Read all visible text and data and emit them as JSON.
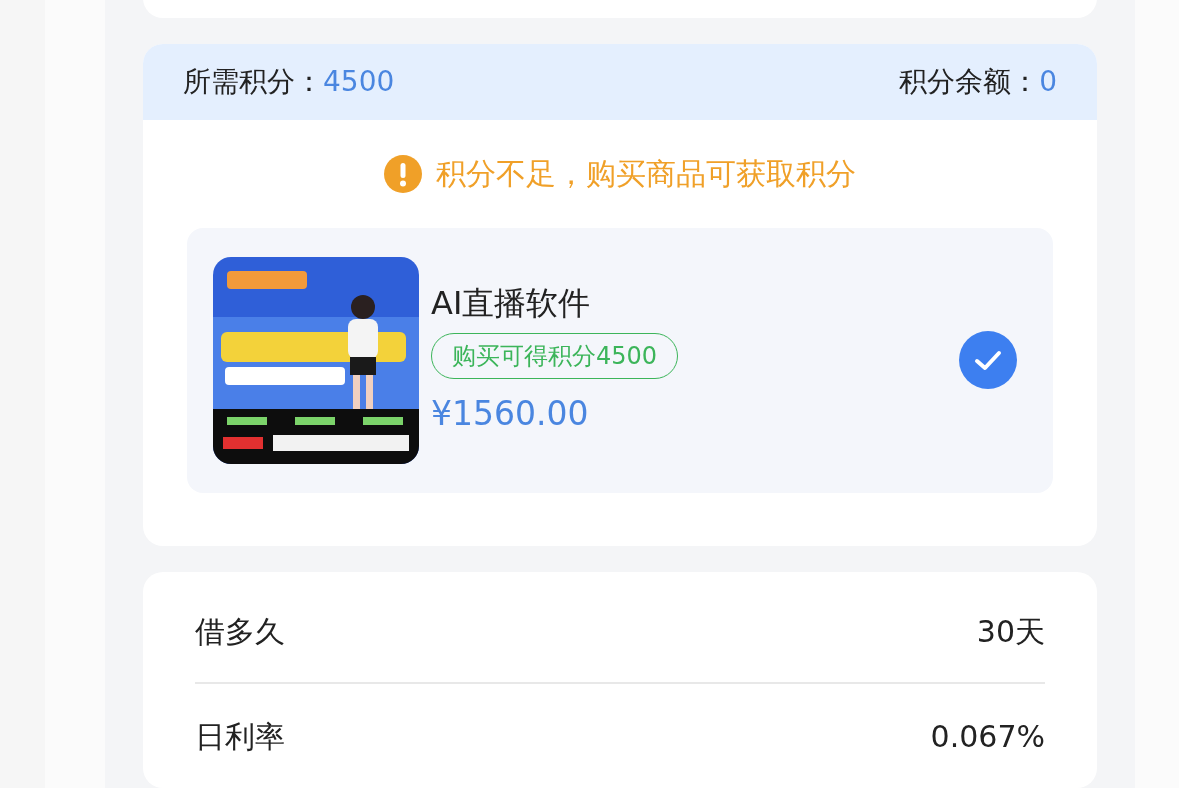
{
  "points": {
    "required_label": "所需积分：",
    "required_value": "4500",
    "balance_label": "积分余额：",
    "balance_value": "0",
    "warning": "积分不足，购买商品可获取积分"
  },
  "products": [
    {
      "name": "AI直播软件",
      "badge": "购买可得积分4500",
      "price": "¥1560.00",
      "selected": true
    }
  ],
  "loan_rows": [
    {
      "label": "借多久",
      "value": "30天"
    },
    {
      "label": "日利率",
      "value": "0.067%"
    }
  ]
}
